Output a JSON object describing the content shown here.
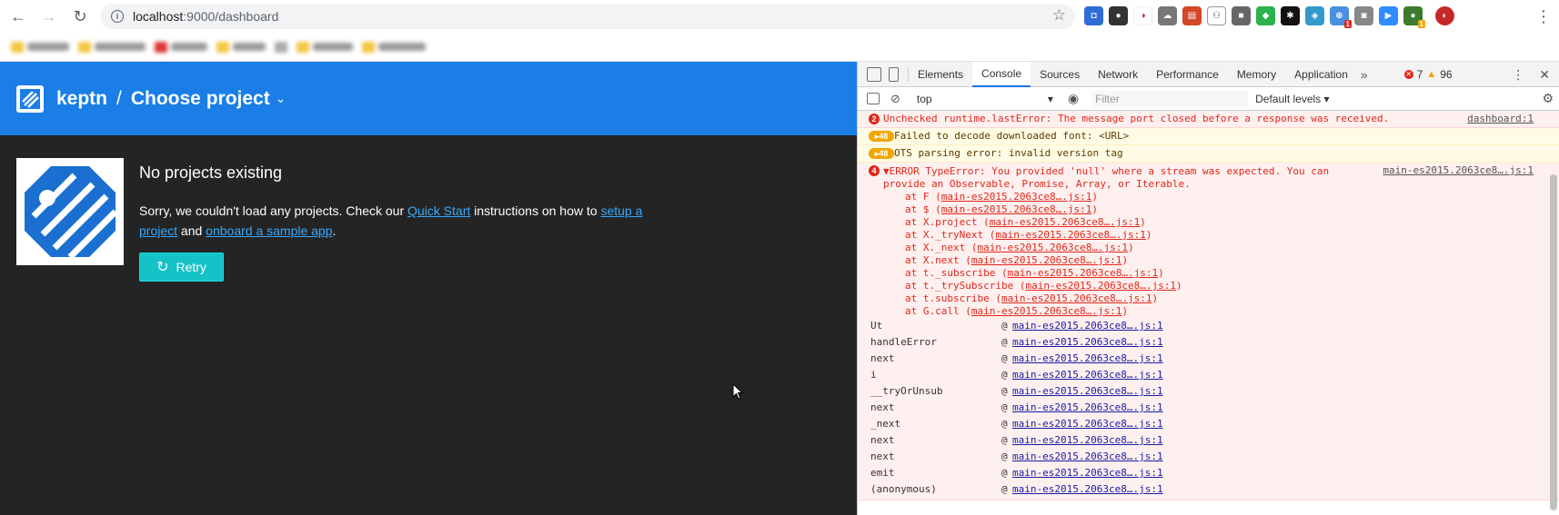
{
  "browser": {
    "url_host": "localhost",
    "url_rest": ":9000/dashboard",
    "extension_badge_1": "1",
    "extension_badge_2": "1"
  },
  "app": {
    "brand": "keptn",
    "separator": "/",
    "project_selector": "Choose project",
    "empty_title": "No projects existing",
    "empty_text_1": "Sorry, we couldn't load any projects. Check our ",
    "quick_start_link": "Quick Start",
    "empty_text_2": " instructions on how to ",
    "setup_link": "setup a project",
    "empty_text_3": " and ",
    "onboard_link": "onboard a sample app",
    "empty_text_4": ".",
    "retry_label": "Retry"
  },
  "devtools": {
    "tabs": [
      "Elements",
      "Console",
      "Sources",
      "Network",
      "Performance",
      "Memory",
      "Application"
    ],
    "more": "»",
    "error_count": "7",
    "warning_count": "96",
    "context": "top",
    "filter_placeholder": "Filter",
    "levels": "Default levels"
  },
  "console": {
    "msg1": {
      "count": "2",
      "text": "Unchecked runtime.lastError: The message port closed before a response was received.",
      "src": "dashboard:1"
    },
    "msg2": {
      "count": "48",
      "text": "Failed to decode downloaded font: <URL>"
    },
    "msg3": {
      "count": "48",
      "text": "OTS parsing error: invalid version tag"
    },
    "msg4": {
      "count": "4",
      "text": "▼ERROR TypeError: You provided 'null' where a stream was expected. You can provide an Observable, Promise, Array, or Iterable.",
      "src": "main-es2015.2063ce8….js:1",
      "trace": [
        {
          "pre": "at F (",
          "link": "main-es2015.2063ce8….js:1",
          "post": ")"
        },
        {
          "pre": "at $ (",
          "link": "main-es2015.2063ce8….js:1",
          "post": ")"
        },
        {
          "pre": "at X.project (",
          "link": "main-es2015.2063ce8….js:1",
          "post": ")"
        },
        {
          "pre": "at X._tryNext (",
          "link": "main-es2015.2063ce8….js:1",
          "post": ")"
        },
        {
          "pre": "at X._next (",
          "link": "main-es2015.2063ce8….js:1",
          "post": ")"
        },
        {
          "pre": "at X.next (",
          "link": "main-es2015.2063ce8….js:1",
          "post": ")"
        },
        {
          "pre": "at t._subscribe (",
          "link": "main-es2015.2063ce8….js:1",
          "post": ")"
        },
        {
          "pre": "at t._trySubscribe (",
          "link": "main-es2015.2063ce8….js:1",
          "post": ")"
        },
        {
          "pre": "at t.subscribe (",
          "link": "main-es2015.2063ce8….js:1",
          "post": ")"
        },
        {
          "pre": "at G.call (",
          "link": "main-es2015.2063ce8….js:1",
          "post": ")"
        }
      ],
      "stack": [
        {
          "fn": "Ut",
          "link": "main-es2015.2063ce8….js:1"
        },
        {
          "fn": "handleError",
          "link": "main-es2015.2063ce8….js:1"
        },
        {
          "fn": "next",
          "link": "main-es2015.2063ce8….js:1"
        },
        {
          "fn": "i",
          "link": "main-es2015.2063ce8….js:1"
        },
        {
          "fn": "__tryOrUnsub",
          "link": "main-es2015.2063ce8….js:1"
        },
        {
          "fn": "next",
          "link": "main-es2015.2063ce8….js:1"
        },
        {
          "fn": "_next",
          "link": "main-es2015.2063ce8….js:1"
        },
        {
          "fn": "next",
          "link": "main-es2015.2063ce8….js:1"
        },
        {
          "fn": "next",
          "link": "main-es2015.2063ce8….js:1"
        },
        {
          "fn": "emit",
          "link": "main-es2015.2063ce8….js:1"
        },
        {
          "fn": "(anonymous)",
          "link": "main-es2015.2063ce8….js:1"
        }
      ]
    }
  }
}
